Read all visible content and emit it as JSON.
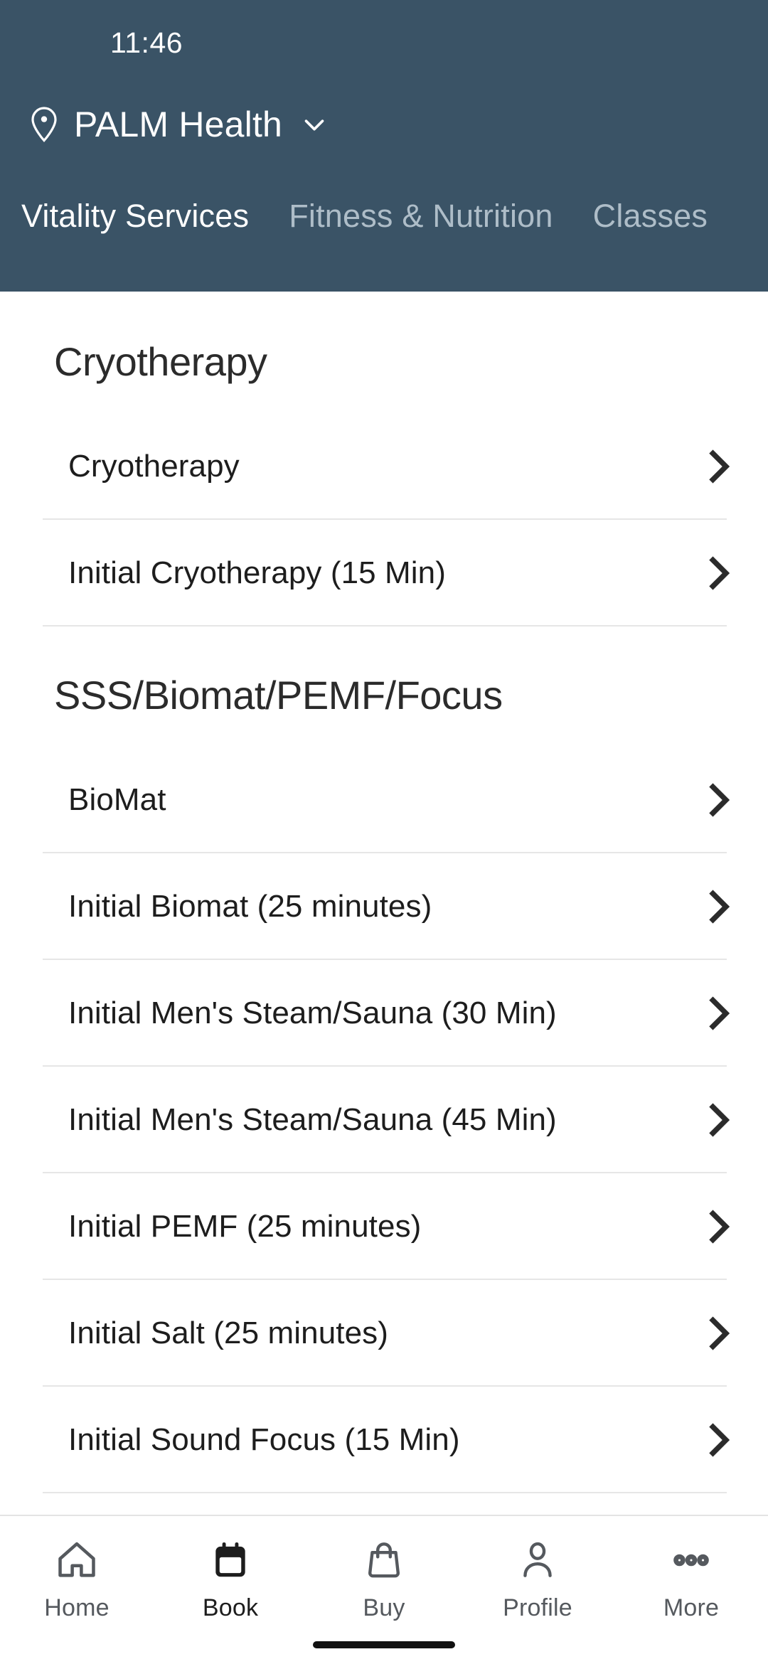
{
  "status_bar": {
    "time": "11:46"
  },
  "header": {
    "location_icon": "location-pin-icon",
    "location_name": "PALM Health",
    "caret_icon": "chevron-down-icon",
    "background_color": "#3a5366",
    "active_tab_color": "#ffffff",
    "inactive_tab_color": "#aebdc8"
  },
  "tabs": [
    {
      "label": "Vitality Services",
      "active": true
    },
    {
      "label": "Fitness & Nutrition",
      "active": false
    },
    {
      "label": "Classes",
      "active": false
    }
  ],
  "sections": [
    {
      "title": "Cryotherapy",
      "rows": [
        {
          "label": "Cryotherapy"
        },
        {
          "label": "Initial Cryotherapy (15 Min)"
        }
      ]
    },
    {
      "title": "SSS/Biomat/PEMF/Focus",
      "rows": [
        {
          "label": "BioMat"
        },
        {
          "label": "Initial Biomat (25 minutes)"
        },
        {
          "label": "Initial Men's Steam/Sauna (30 Min)"
        },
        {
          "label": "Initial Men's Steam/Sauna (45 Min)"
        },
        {
          "label": "Initial PEMF (25 minutes)"
        },
        {
          "label": "Initial Salt (25 minutes)"
        },
        {
          "label": "Initial Sound Focus (15 Min)"
        }
      ]
    }
  ],
  "row_chevron_icon": "chevron-right-icon",
  "bottom_nav": [
    {
      "label": "Home",
      "icon": "home-icon",
      "active": false
    },
    {
      "label": "Book",
      "icon": "calendar-icon",
      "active": true
    },
    {
      "label": "Buy",
      "icon": "shopping-bag-icon",
      "active": false
    },
    {
      "label": "Profile",
      "icon": "person-icon",
      "active": false
    },
    {
      "label": "More",
      "icon": "ellipsis-icon",
      "active": false
    }
  ]
}
